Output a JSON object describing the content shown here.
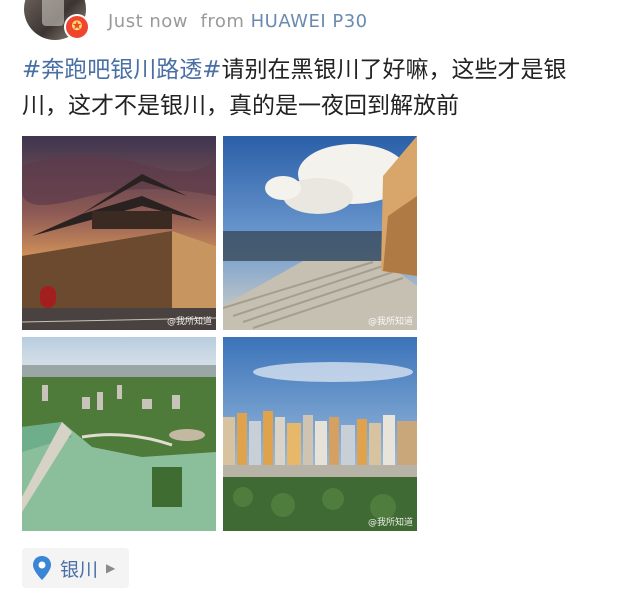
{
  "header": {
    "time": "Just now",
    "from_prefix": "from",
    "device": "HUAWEI P30"
  },
  "post": {
    "hashtag": "#奔跑吧银川路透#",
    "text_line1": "请别在黑银川了好嘛，这些才是银",
    "text_line2": "川，这才不是银川，真的是一夜回到解放前"
  },
  "images": [
    {
      "watermark": "@我所知道"
    },
    {
      "watermark": "@我所知道"
    },
    {
      "watermark": ""
    },
    {
      "watermark": "@我所知道"
    }
  ],
  "location": {
    "label": "银川",
    "chevron": "▶"
  },
  "colors": {
    "link": "#4a6fa5",
    "meta": "#9a9a9a",
    "badge": "#f0462f"
  }
}
